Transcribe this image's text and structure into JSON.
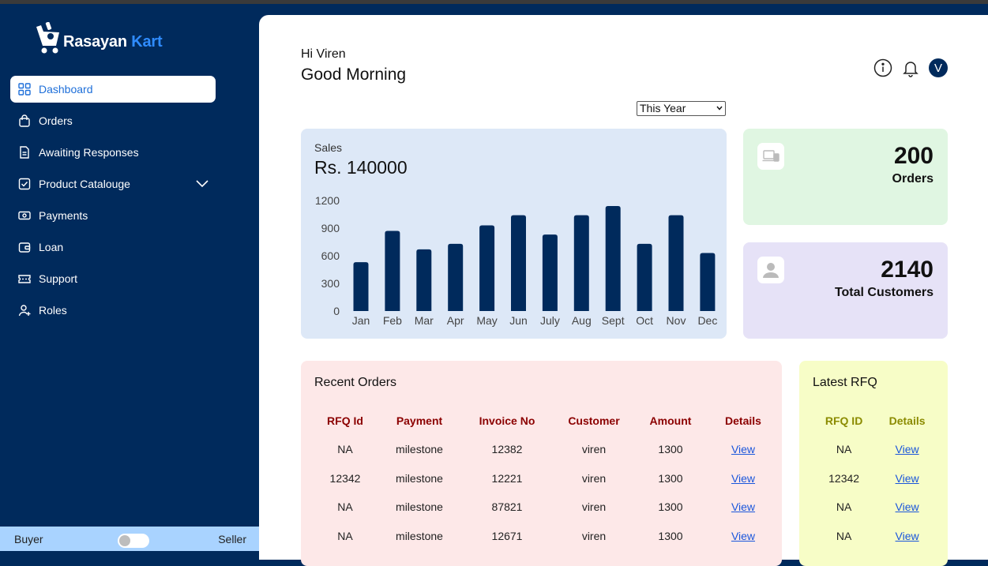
{
  "brand": {
    "part1": "Rasayan",
    "part2": "Kart"
  },
  "sidebar": {
    "items": [
      {
        "label": "Dashboard",
        "icon": "grid-icon"
      },
      {
        "label": "Orders",
        "icon": "bag-icon"
      },
      {
        "label": "Awaiting Responses",
        "icon": "document-icon"
      },
      {
        "label": "Product Catalouge",
        "icon": "checkbox-icon"
      },
      {
        "label": "Payments",
        "icon": "money-icon"
      },
      {
        "label": "Loan",
        "icon": "wallet-icon"
      },
      {
        "label": "Support",
        "icon": "ticket-icon"
      },
      {
        "label": "Roles",
        "icon": "user-plus-icon"
      }
    ],
    "switch": {
      "left": "Buyer",
      "right": "Seller"
    }
  },
  "header": {
    "greeting": "Hi Viren",
    "salutation": "Good Morning",
    "avatar_letter": "V"
  },
  "filter": {
    "selected": "This Year"
  },
  "sales": {
    "label": "Sales",
    "value": "Rs. 140000"
  },
  "stats": {
    "orders": {
      "value": "200",
      "label": "Orders"
    },
    "customers": {
      "value": "2140",
      "label": "Total Customers"
    }
  },
  "colors": {
    "sidebar": "#002a5c",
    "accent": "#1e6fd9",
    "bar": "#002a5c"
  },
  "chart_data": {
    "type": "bar",
    "categories": [
      "Jan",
      "Feb",
      "Mar",
      "Apr",
      "May",
      "Jun",
      "July",
      "Aug",
      "Sept",
      "Oct",
      "Nov",
      "Dec"
    ],
    "values": [
      530,
      870,
      670,
      730,
      930,
      1040,
      830,
      1040,
      1140,
      730,
      1040,
      630
    ],
    "yticks": [
      0,
      300,
      600,
      900,
      1200
    ],
    "ylim": [
      0,
      1200
    ]
  },
  "recent_orders": {
    "title": "Recent Orders",
    "columns": [
      "RFQ Id",
      "Payment",
      "Invoice No",
      "Customer",
      "Amount",
      "Details"
    ],
    "rows": [
      [
        "NA",
        "milestone",
        "12382",
        "viren",
        "1300",
        "View"
      ],
      [
        "12342",
        "milestone",
        "12221",
        "viren",
        "1300",
        "View"
      ],
      [
        "NA",
        "milestone",
        "87821",
        "viren",
        "1300",
        "View"
      ],
      [
        "NA",
        "milestone",
        "12671",
        "viren",
        "1300",
        "View"
      ]
    ]
  },
  "latest_rfq": {
    "title": "Latest RFQ",
    "columns": [
      "RFQ ID",
      "Details"
    ],
    "rows": [
      [
        "NA",
        "View"
      ],
      [
        "12342",
        "View"
      ],
      [
        "NA",
        "View"
      ],
      [
        "NA",
        "View"
      ]
    ]
  }
}
